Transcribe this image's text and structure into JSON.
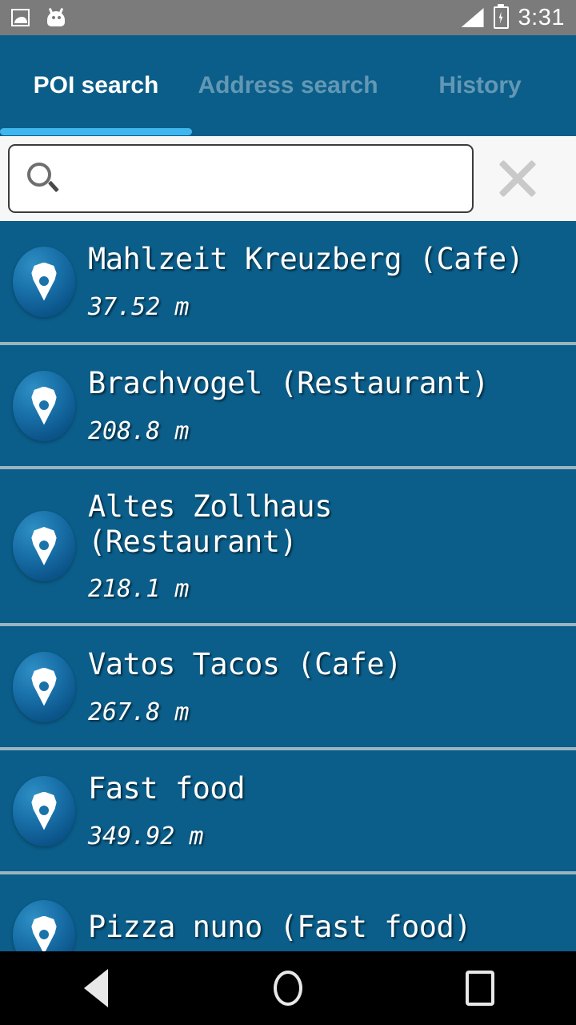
{
  "status_bar": {
    "time": "3:31",
    "icons": [
      "photo-icon",
      "android-robot-icon",
      "signal-icon",
      "battery-charging-icon"
    ]
  },
  "tabs": [
    {
      "label": "POI search",
      "active": true
    },
    {
      "label": "Address search",
      "active": false
    },
    {
      "label": "History",
      "active": false
    }
  ],
  "search": {
    "value": "",
    "placeholder": "",
    "clear_label": "×",
    "search_icon": "magnifier-icon"
  },
  "poi_list": [
    {
      "title": "Mahlzeit Kreuzberg (Cafe)",
      "distance": "37.52 m"
    },
    {
      "title": "Brachvogel (Restaurant)",
      "distance": "208.8 m"
    },
    {
      "title": "Altes Zollhaus (Restaurant)",
      "distance": "218.1 m"
    },
    {
      "title": "Vatos Tacos (Cafe)",
      "distance": "267.8 m"
    },
    {
      "title": "Fast food",
      "distance": "349.92 m"
    },
    {
      "title": "Pizza nuno (Fast food)",
      "distance": ""
    }
  ],
  "nav_bar": {
    "back": "back-button",
    "home": "home-button",
    "recents": "recents-button"
  },
  "colors": {
    "app_blue": "#0b5e8a",
    "status_gray": "#7b7b7b",
    "tab_indicator": "#3fb7ee",
    "separator": "#9cb4bf",
    "nav_black": "#000000"
  }
}
